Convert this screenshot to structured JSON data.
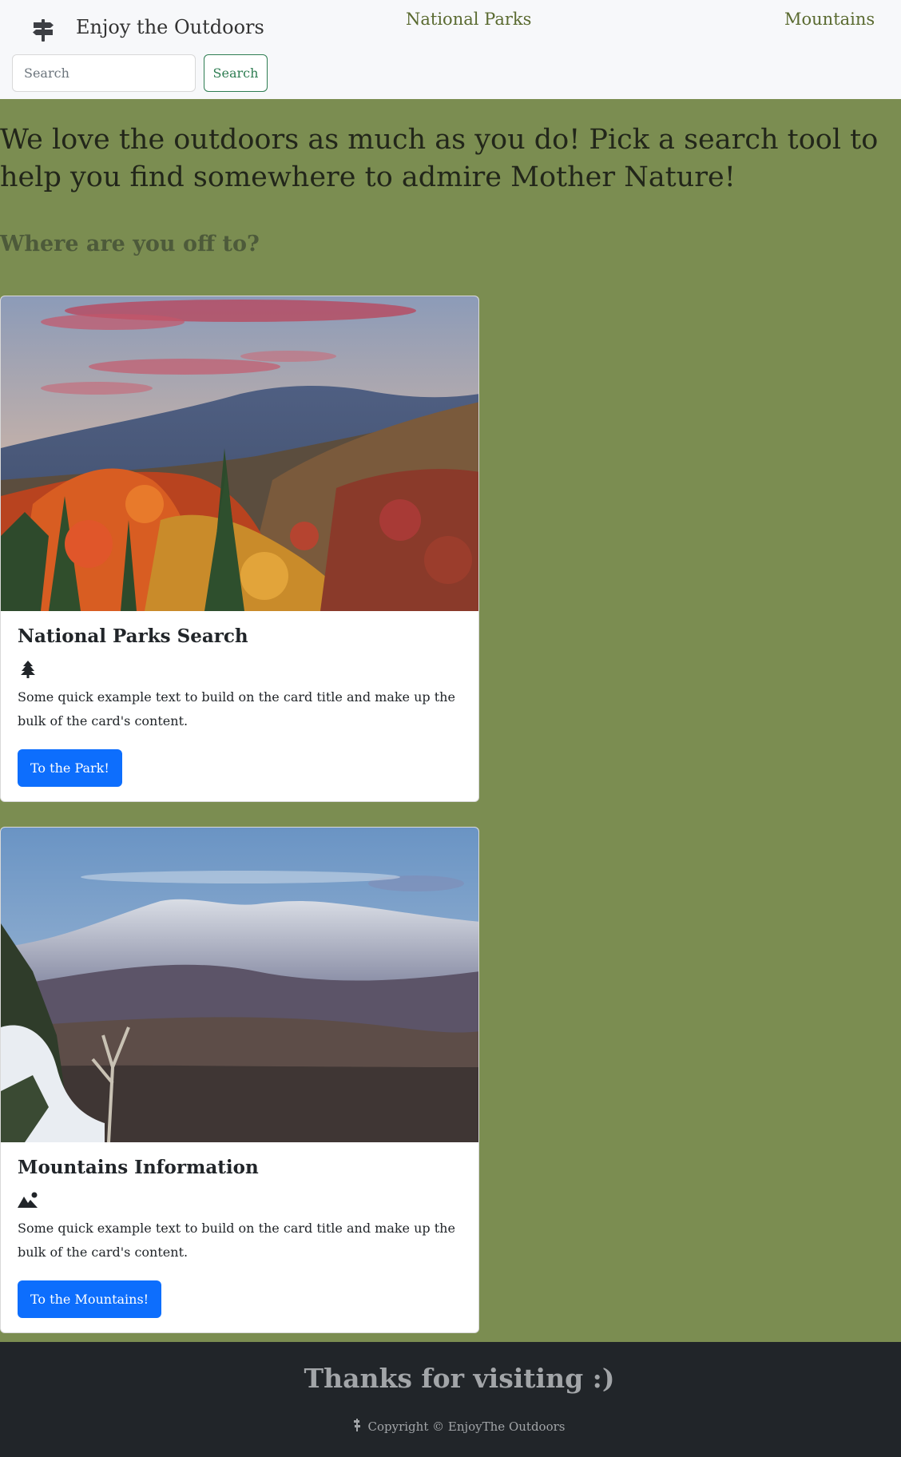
{
  "navbar": {
    "brand_icon": "signpost-icon",
    "brand_text": "Enjoy the Outdoors",
    "links": [
      {
        "label": "National Parks"
      },
      {
        "label": "Mountains"
      }
    ],
    "search": {
      "placeholder": "Search",
      "value": "",
      "button_label": "Search"
    }
  },
  "hero": {
    "lead": "We love the outdoors as much as you do! Pick a search tool to help you find somewhere to admire Mother Nature!",
    "subhead": "Where are you off to?"
  },
  "cards": [
    {
      "image": "autumn-mountain-forest-photo",
      "title": "National Parks Search",
      "icon": "tree-icon",
      "text": "Some quick example text to build on the card title and make up the bulk of the card's content.",
      "button_label": "To the Park!"
    },
    {
      "image": "snowy-mountain-range-photo",
      "title": "Mountains Information",
      "icon": "mountain-sun-icon",
      "text": "Some quick example text to build on the card title and make up the bulk of the card's content.",
      "button_label": "To the Mountains!"
    }
  ],
  "footer": {
    "title": "Thanks for visiting :)",
    "icon": "signpost-icon",
    "copyright": "Copyright © EnjoyThe Outdoors"
  },
  "colors": {
    "page_background": "#7b8d51",
    "navbar_background": "#f7f8fa",
    "nav_link": "#5a6a30",
    "primary_button": "#0d6efd",
    "search_button": "#2e7d52",
    "footer_background": "#212529"
  }
}
